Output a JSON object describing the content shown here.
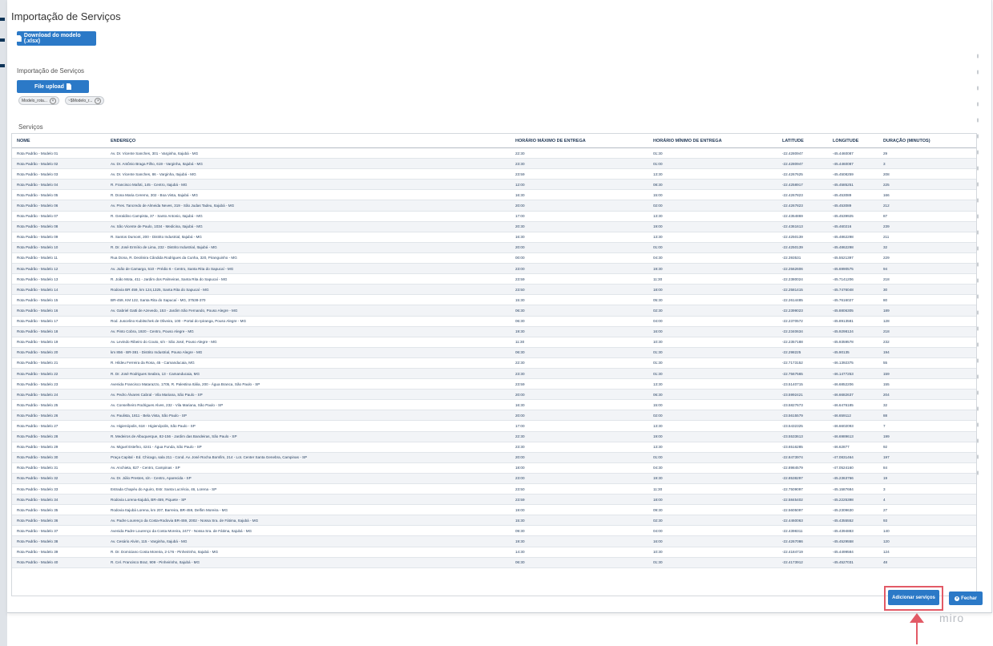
{
  "title": "Importação de Serviços",
  "download_button": "Download do modelo (.xlsx)",
  "import_section_label": "Importação de Serviços",
  "file_upload_button": "File upload",
  "chips": [
    "Modelo_rota...",
    "~$Modelo_r..."
  ],
  "services_section_label": "Serviços",
  "columns": [
    "NOME",
    "ENDEREÇO",
    "HORÁRIO MÁXIMO DE ENTREGA",
    "HORÁRIO MÍNIMO DE ENTREGA",
    "LATITUDE",
    "LONGITUDE",
    "DURAÇÃO (MINUTOS)"
  ],
  "rows": [
    [
      "Rota Padrão - Modelo 01",
      "Av. Dr. Vicente Sanches, 301 - Varginha, Itajubá - MG",
      "22:30",
      "01:30",
      "-22.4280947",
      "-45.4460087",
      "29"
    ],
    [
      "Rota Padrão - Modelo 02",
      "Av. Dr. Antônio Braga Filho, 619 - Varginha, Itajubá - MG",
      "23:30",
      "01:00",
      "-22.4280947",
      "-45.4460087",
      "3"
    ],
    [
      "Rota Padrão - Modelo 03",
      "Av. Dr. Vicente Sanches, 86 - Varginha, Itajubá - MG",
      "23:59",
      "13:30",
      "-22.4267625",
      "-45.4508259",
      "208"
    ],
    [
      "Rota Padrão - Modelo 04",
      "R. Francisco Mafoti, 145 - Centro, Itajubá - MG",
      "12:00",
      "08:30",
      "-22.4258917",
      "-45.4585251",
      "225"
    ],
    [
      "Rota Padrão - Modelo 05",
      "R. Dona Maria Ceremo, 302 - Boa Vista, Itajubá - MG",
      "16:30",
      "15:00",
      "-22.4267823",
      "-45.453089",
      "166"
    ],
    [
      "Rota Padrão - Modelo 06",
      "Av. Pres. Tancredo de Almeida Neves, 319 - São Judas Tadeu, Itajubá - MG",
      "20:00",
      "02:00",
      "-22.4267823",
      "-45.453089",
      "212"
    ],
    [
      "Rota Padrão - Modelo 07",
      "R. Geraldino Campista, 37 - Santo Antonio, Itajubá - MG",
      "17:00",
      "13:30",
      "-22.4354869",
      "-45.4539925",
      "87"
    ],
    [
      "Rota Padrão - Modelo 08",
      "Av. São Vicente de Paulo, 1034 - Medicina, Itajubá - MG",
      "20:30",
      "19:00",
      "-22.4361613",
      "-45.460216",
      "239"
    ],
    [
      "Rota Padrão - Modelo 09",
      "R. Santos Dumont, 200 - Distrito Industrial, Itajubá - MG",
      "16:30",
      "13:30",
      "-22.4250139",
      "-45.4862298",
      "211"
    ],
    [
      "Rota Padrão - Modelo 10",
      "R. Dr. José Ermírio de Lima, 232 - Distrito Industrial, Itajubá - MG",
      "20:00",
      "01:00",
      "-22.4250139",
      "-45.4862298",
      "32"
    ],
    [
      "Rota Padrão - Modelo 11",
      "Rua Dona, R. Deolinira Cândida Rodrigues da Cunha, 320, Piranguinho - MG",
      "00:00",
      "04:30",
      "-22.393531",
      "-45.5521397",
      "229"
    ],
    [
      "Rota Padrão - Modelo 12",
      "Av. João de Camargo, 510 - Prédio 6 - Centro, Santa Rita do Sapucaí - MG",
      "23:00",
      "19:30",
      "-22.2562606",
      "-45.6990575",
      "94"
    ],
    [
      "Rota Padrão - Modelo 13",
      "R. João Mota, 411 - Jardim dos Palmeiras, Santa Rita do Sapucaí - MG",
      "23:59",
      "11:30",
      "-22.2380024",
      "-45.7141206",
      "218"
    ],
    [
      "Rota Padrão - Modelo 14",
      "Rodovia BR 459, km 124,1325, Santa Rita do Sapucaí - MG",
      "23:50",
      "18:00",
      "-22.2581415",
      "-45.7476048",
      "30"
    ],
    [
      "Rota Padrão - Modelo 15",
      "BR-459, KM 122, Santa Rita do Sapucaí - MG, 37538-370",
      "15:30",
      "05:30",
      "-22.2614485",
      "-45.7616027",
      "80"
    ],
    [
      "Rota Padrão - Modelo 16",
      "Av. Gabriel Gatti de Azevedo, 153 - Jardim São Fernando, Pouso Alegre - MG",
      "06:30",
      "02:30",
      "-22.2399023",
      "-45.8806305",
      "189"
    ],
    [
      "Rota Padrão - Modelo 17",
      "Rod. Juscelino Kubitschek de Oliveira, 100 - Portal do Ipiranga, Pouso Alegre - MG",
      "06:30",
      "04:00",
      "-22.2370572",
      "-45.8913581",
      "128"
    ],
    [
      "Rota Padrão - Modelo 18",
      "Av. Pinto Cobra, 1920 - Centro, Pouso Alegre - MG",
      "19:30",
      "16:00",
      "-22.2340634",
      "-45.9298124",
      "218"
    ],
    [
      "Rota Padrão - Modelo 19",
      "Av. Levindo Ribeiro do Couto, s/n - São José, Pouso Alegre - MG",
      "11:30",
      "10:30",
      "-22.2357188",
      "-45.9359578",
      "232"
    ],
    [
      "Rota Padrão - Modelo 20",
      "km 856 - BR-381 - Distrito Industrial, Pouso Alegre - MG",
      "06:30",
      "01:30",
      "-22.298225",
      "-45.90135",
      "194"
    ],
    [
      "Rota Padrão - Modelo 21",
      "R. Hildeu Ferreira da Rosa, 45 - Camanducaia, MG",
      "22:30",
      "01:30",
      "-22.7173152",
      "-46.1392375",
      "55"
    ],
    [
      "Rota Padrão - Modelo 22",
      "R. Dr. José Rodrigues Seabra, 13 - Camanducaia, MG",
      "23:30",
      "01:30",
      "-22.7567565",
      "-46.1477253",
      "159"
    ],
    [
      "Rota Padrão - Modelo 23",
      "Avenida Francisco Matarazzo, 1705, R. Palestina Itália, 200 - Água Branca, São Paulo - SP",
      "23:59",
      "13:30",
      "-23.5140715",
      "-46.6852206",
      "155"
    ],
    [
      "Rota Padrão - Modelo 24",
      "Av. Pedro Álvares Cabral - Vila Mariana, São Paulo - SP",
      "20:00",
      "06:30",
      "-23.5992421",
      "-46.6682637",
      "204"
    ],
    [
      "Rota Padrão - Modelo 25",
      "Av. Conselheiro Rodrigues Alves, 232 - Vila Mariana, São Paulo - SP",
      "16:30",
      "15:00",
      "-23.5827673",
      "-46.6476185",
      "32"
    ],
    [
      "Rota Padrão - Modelo 26",
      "Av. Paulista, 1811 - Bela Vista, São Paulo - SP",
      "20:00",
      "02:00",
      "-23.5615579",
      "-46.659112",
      "88"
    ],
    [
      "Rota Padrão - Modelo 27",
      "Av. Higienópolis, 618 - Higienópolis, São Paulo - SP",
      "17:00",
      "13:30",
      "-23.5432325",
      "-46.6602093",
      "7"
    ],
    [
      "Rota Padrão - Modelo 28",
      "R. Medeiros de Albuquerque, 82-156 - Jardim das Bandeiras, São Paulo - SP",
      "22:30",
      "19:00",
      "-23.5533613",
      "-46.6989613",
      "199"
    ],
    [
      "Rota Padrão - Modelo 29",
      "Av. Miguel Estefno, 4241 - Água Funda, São Paulo - SP",
      "23:30",
      "13:30",
      "-23.6516285",
      "-46.62877",
      "92"
    ],
    [
      "Rota Padrão - Modelo 30",
      "Praça Capital - Ed. Chicago, sala 211 - Cond. Av. José Rocha Bomfim, 214 - Lot. Center Santa Genebra, Campinas - SP",
      "20:00",
      "01:00",
      "-22.8473974",
      "-47.0831464",
      "197"
    ],
    [
      "Rota Padrão - Modelo 31",
      "Av. Anchieta, 827 - Centro, Campinas - SP",
      "18:00",
      "04:30",
      "-22.8984579",
      "-47.0524160",
      "84"
    ],
    [
      "Rota Padrão - Modelo 32",
      "Av. Dr. Júlio Prestes, s/n - Centro, Aparecida - SP",
      "23:00",
      "19:30",
      "-22.8538297",
      "-45.2363766",
      "19"
    ],
    [
      "Rota Padrão - Modelo 33",
      "Estrada Chapéu do Aguiro, Estr. Santa Lucrécia, 46, Lorena - SP",
      "23:50",
      "11:30",
      "-22.7509097",
      "-45.1587684",
      "3"
    ],
    [
      "Rota Padrão - Modelo 34",
      "Rodovia Lorena-Itajubá, BR-459, Piquete - SP",
      "23:59",
      "18:00",
      "-22.5845402",
      "-45.2225398",
      "4"
    ],
    [
      "Rota Padrão - Modelo 35",
      "Rodovia Itajubá Lorena, km 207, Barreira, BR-459, Delfim Moreira - MG",
      "19:00",
      "09:30",
      "-22.5605097",
      "-45.2309630",
      "27"
    ],
    [
      "Rota Padrão - Modelo 36",
      "Av. Padre Lourenço da Costa-Rodovia BR-459, 2002 - Nossa Sra. de Fátima, Itajubá - MG",
      "15:30",
      "02:30",
      "-22.4460063",
      "-45.4355552",
      "93"
    ],
    [
      "Rota Padrão - Modelo 37",
      "Avenida Padre Lourenço da Costa Moreira, 2477 - Nossa Sra. de Fátima, Itajubá - MG",
      "09:30",
      "04:00",
      "-22.4398311",
      "-45.4394883",
      "140"
    ],
    [
      "Rota Padrão - Modelo 38",
      "Av. Cesário Alvim, 115 - Varginha, Itajubá - MG",
      "19:30",
      "16:00",
      "-22.4267086",
      "-45.4529558",
      "120"
    ],
    [
      "Rota Padrão - Modelo 39",
      "R. Dr. Domiciano Costa Moreira, 2-176 - Pinheirinho, Itajubá - MG",
      "14:30",
      "10:30",
      "-22.4184719",
      "-45.4499584",
      "124"
    ],
    [
      "Rota Padrão - Modelo 40",
      "R. Cel. Francisco Braz, 909 - Pinheirinho, Itajubá - MG",
      "06:30",
      "01:30",
      "-22.4173912",
      "-45.4527031",
      "48"
    ]
  ],
  "add_button": "Adicionar serviços",
  "close_button": "Fechar",
  "watermark": "miro",
  "colors": {
    "primary": "#2b79c7",
    "highlight": "#e25a66"
  }
}
